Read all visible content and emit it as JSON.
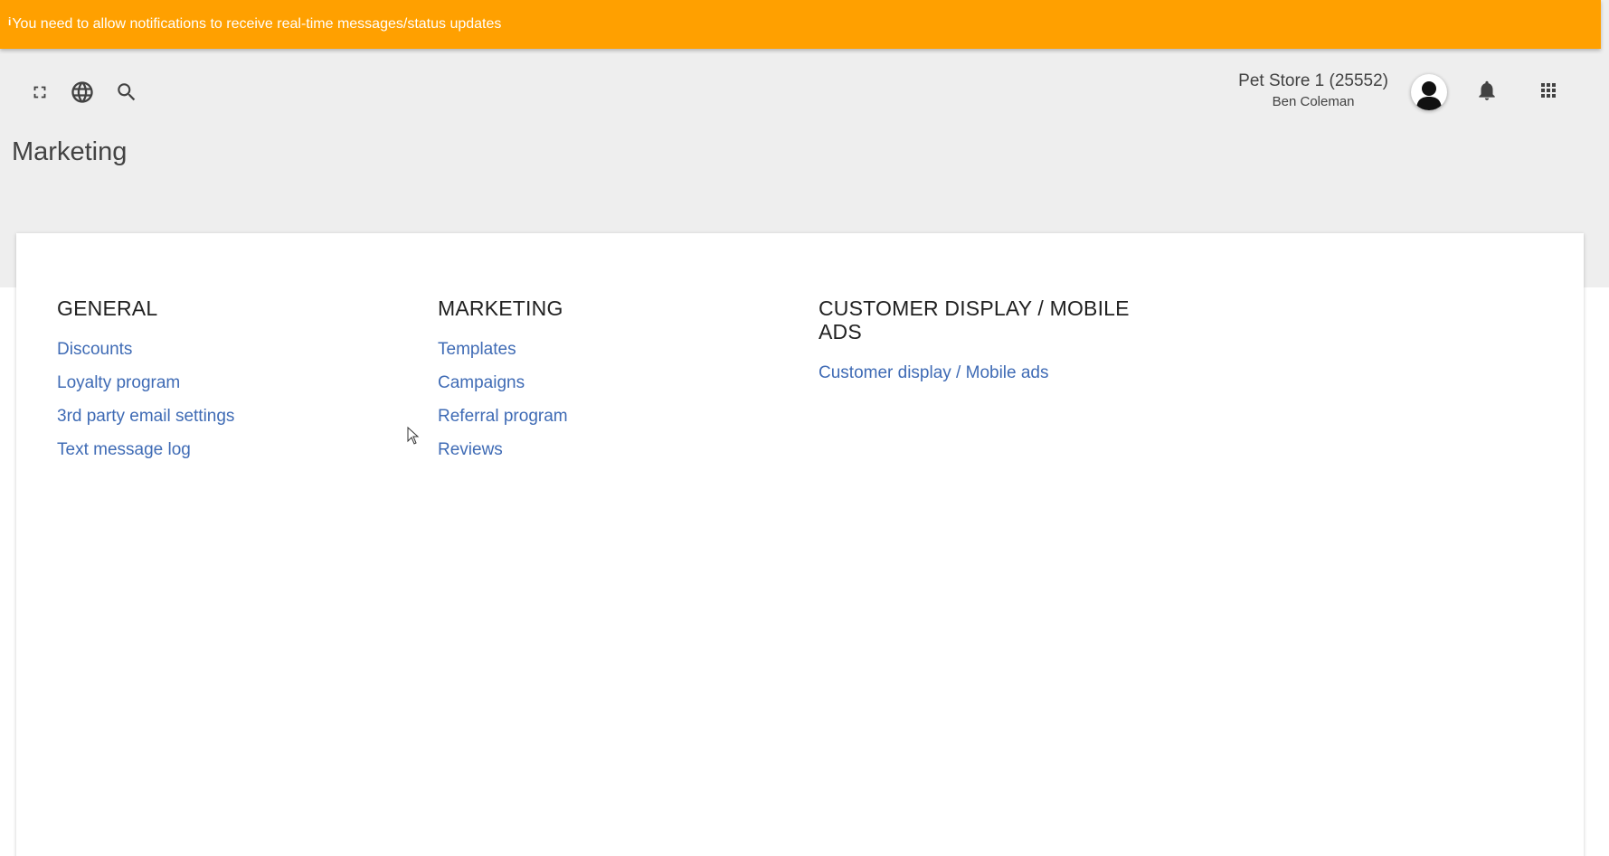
{
  "banner": {
    "icon": "info-icon",
    "message": "You need to allow notifications to receive real-time messages/status updates",
    "color": "#ffa000"
  },
  "toolbar": {
    "icons": [
      "fullscreen-icon",
      "globe-icon",
      "search-icon"
    ]
  },
  "header": {
    "store_name": "Pet Store 1 (25552)",
    "user_name": "Ben Coleman",
    "icons": [
      "avatar-icon",
      "bell-icon",
      "apps-grid-icon"
    ]
  },
  "page": {
    "title": "Marketing"
  },
  "sections": {
    "general": {
      "heading": "GENERAL",
      "links": [
        "Discounts",
        "Loyalty program",
        "3rd party email settings",
        "Text message log"
      ]
    },
    "marketing": {
      "heading": "MARKETING",
      "links": [
        "Templates",
        "Campaigns",
        "Referral program",
        "Reviews"
      ]
    },
    "customer_display": {
      "heading_line1": "CUSTOMER DISPLAY / MOBILE",
      "heading_line2": "ADS",
      "links": [
        "Customer display / Mobile ads"
      ]
    }
  },
  "colors": {
    "link": "#3f6bb5",
    "background": "#eeeeee"
  }
}
